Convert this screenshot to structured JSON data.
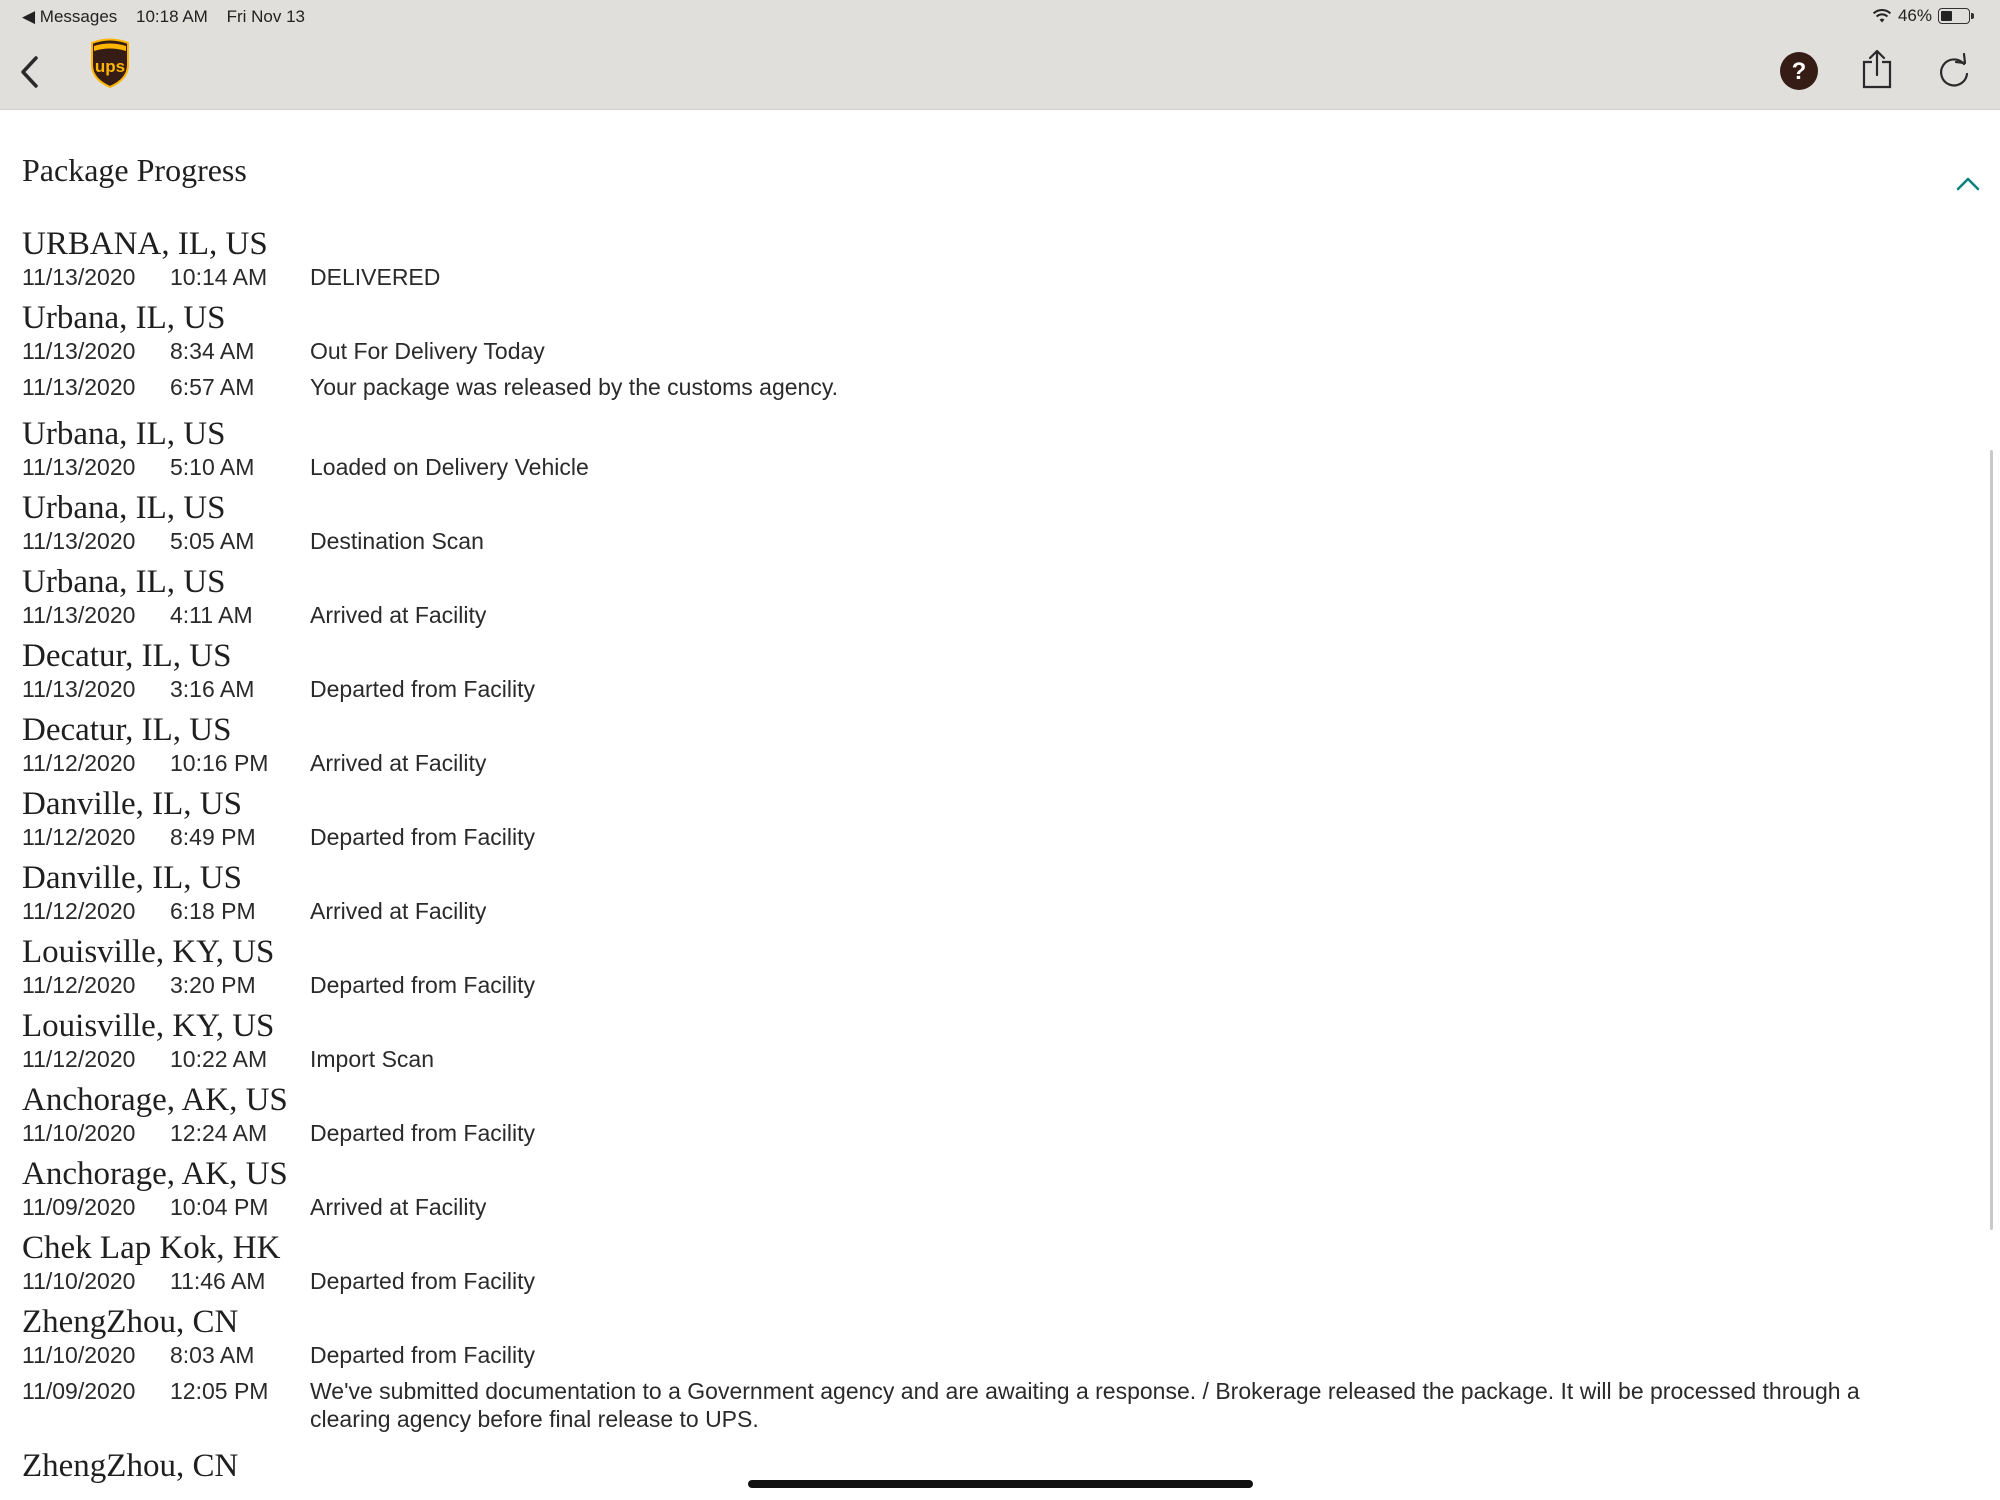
{
  "status_bar": {
    "back_app": "◀ Messages",
    "time": "10:18 AM",
    "date": "Fri Nov 13",
    "battery": "46%",
    "battery_level": 0.46
  },
  "nav": {
    "logo_text": "ups",
    "icons": [
      "back-chevron-icon",
      "ups-logo",
      "help-icon",
      "share-icon",
      "refresh-icon"
    ],
    "colors": {
      "brand_brown": "#351c15",
      "brand_gold": "#ffb500",
      "link_green": "#0a8080"
    }
  },
  "main": {
    "title": "Package Progress",
    "events": [
      {
        "location": "URBANA, IL, US",
        "date": "11/13/2020",
        "time": "10:14 AM",
        "desc": "DELIVERED"
      },
      {
        "location": "Urbana, IL, US",
        "date": "11/13/2020",
        "time": "8:34 AM",
        "desc": "Out For Delivery Today"
      },
      {
        "location": "",
        "date": "11/13/2020",
        "time": "6:57 AM",
        "desc": "Your package was released by the customs agency."
      },
      {
        "location": "Urbana, IL, US",
        "date": "11/13/2020",
        "time": "5:10 AM",
        "desc": "Loaded on Delivery Vehicle"
      },
      {
        "location": "Urbana, IL, US",
        "date": "11/13/2020",
        "time": "5:05 AM",
        "desc": "Destination Scan"
      },
      {
        "location": "Urbana, IL, US",
        "date": "11/13/2020",
        "time": "4:11 AM",
        "desc": "Arrived at Facility"
      },
      {
        "location": "Decatur, IL, US",
        "date": "11/13/2020",
        "time": "3:16 AM",
        "desc": "Departed from Facility"
      },
      {
        "location": "Decatur, IL, US",
        "date": "11/12/2020",
        "time": "10:16 PM",
        "desc": "Arrived at Facility"
      },
      {
        "location": "Danville, IL, US",
        "date": "11/12/2020",
        "time": "8:49 PM",
        "desc": "Departed from Facility"
      },
      {
        "location": "Danville, IL, US",
        "date": "11/12/2020",
        "time": "6:18 PM",
        "desc": "Arrived at Facility"
      },
      {
        "location": "Louisville, KY, US",
        "date": "11/12/2020",
        "time": "3:20 PM",
        "desc": "Departed from Facility"
      },
      {
        "location": "Louisville, KY, US",
        "date": "11/12/2020",
        "time": "10:22 AM",
        "desc": "Import Scan"
      },
      {
        "location": "Anchorage, AK, US",
        "date": "11/10/2020",
        "time": "12:24 AM",
        "desc": "Departed from Facility"
      },
      {
        "location": "Anchorage, AK, US",
        "date": "11/09/2020",
        "time": "10:04 PM",
        "desc": "Arrived at Facility"
      },
      {
        "location": "Chek Lap Kok, HK",
        "date": "11/10/2020",
        "time": "11:46 AM",
        "desc": "Departed from Facility"
      },
      {
        "location": "ZhengZhou, CN",
        "date": "11/10/2020",
        "time": "8:03 AM",
        "desc": "Departed from Facility"
      },
      {
        "location": "",
        "date": "11/09/2020",
        "time": "12:05 PM",
        "desc": "We've submitted documentation to a Government agency and are awaiting a response. / Brokerage released the package. It will be processed through a clearing agency before final release to UPS."
      },
      {
        "location": "ZhengZhou, CN",
        "date": "",
        "time": "",
        "desc": ""
      }
    ]
  }
}
